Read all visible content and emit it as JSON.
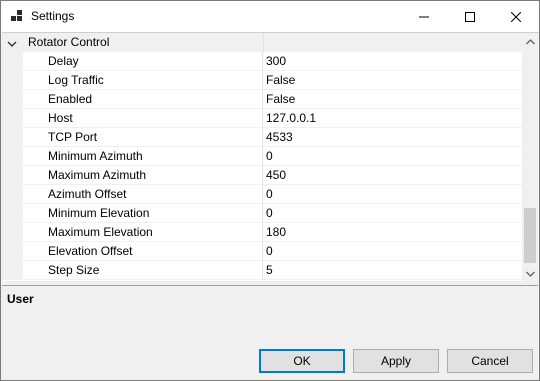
{
  "window": {
    "title": "Settings"
  },
  "category": {
    "label": "Rotator Control"
  },
  "properties": [
    {
      "name": "Delay",
      "value": "300"
    },
    {
      "name": "Log Traffic",
      "value": "False"
    },
    {
      "name": "Enabled",
      "value": "False"
    },
    {
      "name": "Host",
      "value": "127.0.0.1"
    },
    {
      "name": "TCP Port",
      "value": "4533"
    },
    {
      "name": "Minimum Azimuth",
      "value": "0"
    },
    {
      "name": "Maximum Azimuth",
      "value": "450"
    },
    {
      "name": "Azimuth Offset",
      "value": "0"
    },
    {
      "name": "Minimum Elevation",
      "value": "0"
    },
    {
      "name": "Maximum Elevation",
      "value": "180"
    },
    {
      "name": "Elevation Offset",
      "value": "0"
    },
    {
      "name": "Step Size",
      "value": "5"
    }
  ],
  "help": {
    "title": "User"
  },
  "buttons": {
    "ok": "OK",
    "apply": "Apply",
    "cancel": "Cancel"
  },
  "colors": {
    "default_button_border": "#0078d7",
    "grid_background": "#ffffff",
    "window_background": "#f0f0f0"
  }
}
